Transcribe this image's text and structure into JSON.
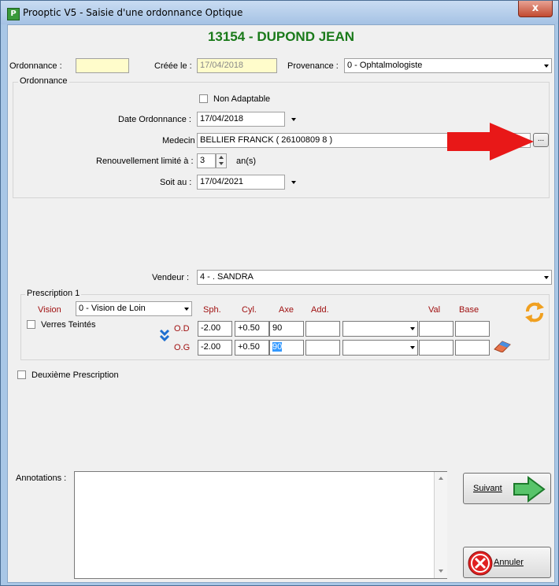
{
  "window": {
    "title": "Prooptic V5 - Saisie d'une ordonnance Optique",
    "app_icon": "P",
    "close_icon": "x"
  },
  "header": {
    "patient": "13154 - DUPOND JEAN"
  },
  "top": {
    "ordonnance_label": "Ordonnance :",
    "ordonnance_value": "",
    "creee_label": "Créée le :",
    "creee_value": "17/04/2018",
    "provenance_label": "Provenance :",
    "provenance_value": "0 - Ophtalmologiste"
  },
  "ordonnance_group": {
    "title": "Ordonnance",
    "non_adaptable_label": "Non Adaptable",
    "non_adaptable_checked": false,
    "date_label": "Date Ordonnance :",
    "date_value": "17/04/2018",
    "medecin_label": "Medecin :",
    "medecin_value": "BELLIER FRANCK  ( 26100809 8 )",
    "medecin_btn": "...",
    "renouvellement_label": "Renouvellement limité à :",
    "renouvellement_value": "3",
    "renouvellement_unit": "an(s)",
    "soit_au_label": "Soit au :",
    "soit_au_value": "17/04/2021"
  },
  "vendeur": {
    "label": "Vendeur :",
    "value": "4 - . SANDRA"
  },
  "prescription": {
    "title": "Prescription 1",
    "vision_label": "Vision",
    "vision_value": "0 - Vision de Loin",
    "verres_teintes_label": "Verres Teintés",
    "columns": {
      "sph": "Sph.",
      "cyl": "Cyl.",
      "axe": "Axe",
      "add": "Add.",
      "val": "Val",
      "base": "Base"
    },
    "rows": [
      {
        "eye": "O.D",
        "sph": "-2.00",
        "cyl": "+0.50",
        "axe": "90",
        "add": "",
        "prism": "",
        "val": "",
        "base": ""
      },
      {
        "eye": "O.G",
        "sph": "-2.00",
        "cyl": "+0.50",
        "axe": "90",
        "add": "",
        "prism": "",
        "val": "",
        "base": ""
      }
    ]
  },
  "deuxieme_prescription": {
    "label": "Deuxième Prescription",
    "checked": false
  },
  "annotations": {
    "label": "Annotations :",
    "value": ""
  },
  "buttons": {
    "suivant": "Suivant",
    "annuler": "Annuler"
  },
  "colors": {
    "header_green": "#1a7a1a",
    "label_red": "#a01010",
    "arrow_red": "#e81818"
  }
}
